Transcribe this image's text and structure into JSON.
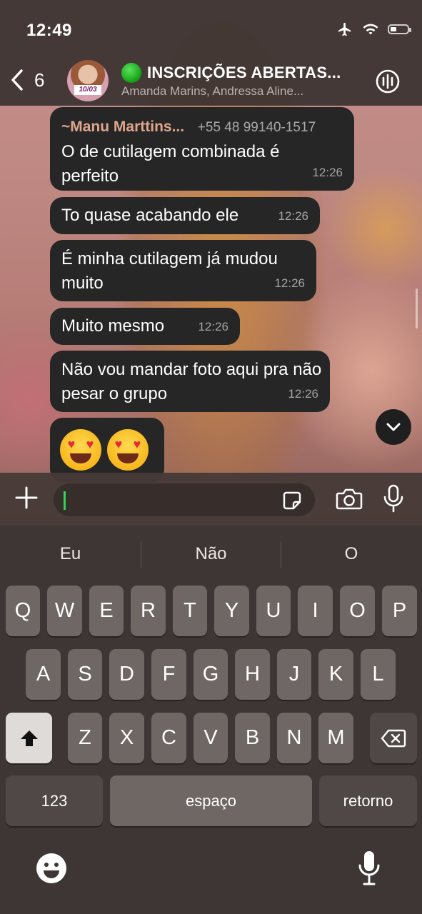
{
  "status_bar": {
    "time": "12:49",
    "icons": [
      "airplane-icon",
      "wifi-icon",
      "battery-icon"
    ]
  },
  "header": {
    "back_count": "6",
    "avatar_badge": "10/03",
    "title": "INSCRIÇÕES ABERTAS...",
    "status_emoji": "green-circle",
    "subtitle": "Amanda Marins, Andressa Aline..."
  },
  "messages": [
    {
      "sender": "~Manu Marttins...",
      "phone": "+55 48 99140-1517",
      "text": "O de cutilagem combinada é perfeito",
      "time": "12:26"
    },
    {
      "text": "To quase acabando ele",
      "time": "12:26"
    },
    {
      "text": "É minha cutilagem já mudou muito",
      "time": "12:26"
    },
    {
      "text": "Muito mesmo",
      "time": "12:26"
    },
    {
      "text": "Não vou mandar foto aqui pra não pesar o grupo",
      "time": "12:26"
    },
    {
      "emoji": "😍😍"
    }
  ],
  "composer": {
    "value": "",
    "icons": [
      "plus-icon",
      "sticker-icon",
      "camera-icon",
      "microphone-icon"
    ]
  },
  "keyboard": {
    "suggestions": [
      "Eu",
      "Não",
      "O"
    ],
    "row1": [
      "Q",
      "W",
      "E",
      "R",
      "T",
      "Y",
      "U",
      "I",
      "O",
      "P"
    ],
    "row2": [
      "A",
      "S",
      "D",
      "F",
      "G",
      "H",
      "J",
      "K",
      "L"
    ],
    "row3": [
      "Z",
      "X",
      "C",
      "V",
      "B",
      "N",
      "M"
    ],
    "numbers_label": "123",
    "space_label": "espaço",
    "return_label": "retorno"
  }
}
